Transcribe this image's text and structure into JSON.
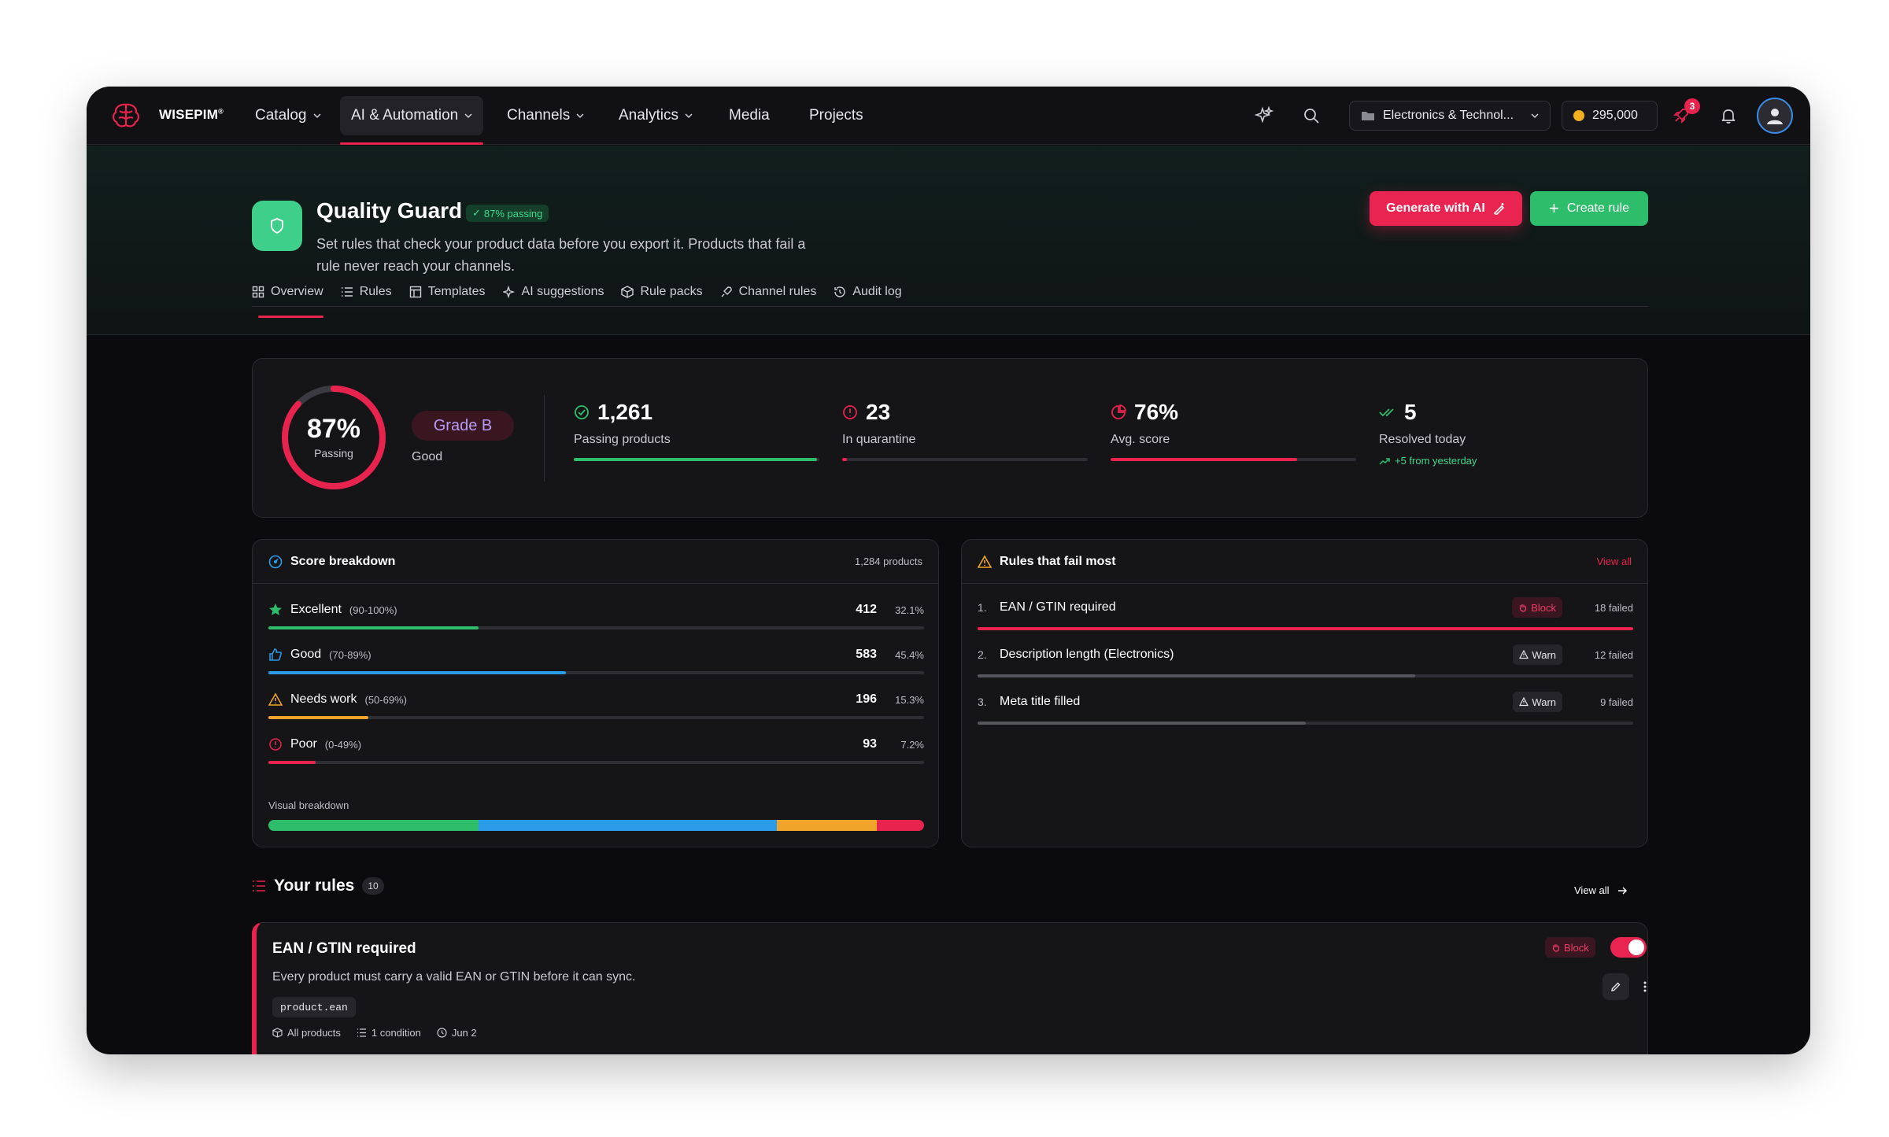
{
  "brand": {
    "name": "WISEPIM",
    "mark": "®"
  },
  "nav": {
    "items": [
      {
        "label": "Catalog",
        "dropdown": true
      },
      {
        "label": "AI & Automation",
        "dropdown": true,
        "active": true
      },
      {
        "label": "Channels",
        "dropdown": true
      },
      {
        "label": "Analytics",
        "dropdown": true
      },
      {
        "label": "Media",
        "dropdown": false
      },
      {
        "label": "Projects",
        "dropdown": false
      }
    ],
    "workspace": "Electronics & Technol...",
    "credits": "295,000",
    "notification_count": "3",
    "icons": [
      "sparkles-icon",
      "search-icon",
      "rocket-icon",
      "bell-icon",
      "user-icon"
    ]
  },
  "header": {
    "title": "Quality Guard",
    "passing_badge": "87% passing",
    "subtitle": "Set rules that check your product data before you export it. Products that fail a rule never reach your channels.",
    "generate_label": "Generate with AI",
    "create_label": "Create rule",
    "tabs": [
      {
        "label": "Overview",
        "icon": "grid-icon",
        "active": true
      },
      {
        "label": "Rules",
        "icon": "list-icon"
      },
      {
        "label": "Templates",
        "icon": "template-icon"
      },
      {
        "label": "AI suggestions",
        "icon": "sparkle-icon"
      },
      {
        "label": "Rule packs",
        "icon": "package-icon"
      },
      {
        "label": "Channel rules",
        "icon": "rocket-icon"
      },
      {
        "label": "Audit log",
        "icon": "history-icon"
      }
    ]
  },
  "overview": {
    "score": {
      "value": "87%",
      "label": "Passing",
      "fraction": 0.87
    },
    "grade": {
      "label": "Grade B",
      "sub": "Good"
    },
    "stats": [
      {
        "value": "1,261",
        "label": "Passing products",
        "fill": 0.99,
        "color": "#2dbd6b",
        "icon": "check-circle-icon"
      },
      {
        "value": "23",
        "label": "In quarantine",
        "fill": 0.02,
        "color": "#e8234d",
        "icon": "alert-circle-icon"
      },
      {
        "value": "76%",
        "label": "Avg. score",
        "fill": 0.76,
        "color": "#e8234d",
        "icon": "pie-icon"
      },
      {
        "value": "5",
        "label": "Resolved today",
        "delta": "+5 from yesterday",
        "icon": "check-double-icon"
      }
    ]
  },
  "score_breakdown": {
    "title": "Score breakdown",
    "total": "1,284 products",
    "rows": [
      {
        "name": "Excellent",
        "range": "(90-100%)",
        "count": "412",
        "pct": "32.1%",
        "fraction": 0.321,
        "color": "#2dbd6b",
        "icon": "star-icon"
      },
      {
        "name": "Good",
        "range": "(70-89%)",
        "count": "583",
        "pct": "45.4%",
        "fraction": 0.454,
        "color": "#2a9ce8",
        "icon": "thumbs-up-icon"
      },
      {
        "name": "Needs work",
        "range": "(50-69%)",
        "count": "196",
        "pct": "15.3%",
        "fraction": 0.153,
        "color": "#f0a52a",
        "icon": "warning-icon"
      },
      {
        "name": "Poor",
        "range": "(0-49%)",
        "count": "93",
        "pct": "7.2%",
        "fraction": 0.072,
        "color": "#e8234d",
        "icon": "alert-circle-icon"
      }
    ],
    "visual_label": "Visual breakdown"
  },
  "failing_rules": {
    "title": "Rules that fail most",
    "view_all": "View all",
    "rows": [
      {
        "index": "1.",
        "name": "EAN / GTIN required",
        "severity": "Block",
        "failed": "18 failed",
        "fraction": 1.0,
        "color": "#e8234d"
      },
      {
        "index": "2.",
        "name": "Description length (Electronics)",
        "severity": "Warn",
        "failed": "12 failed",
        "fraction": 0.667,
        "color": "#55555c"
      },
      {
        "index": "3.",
        "name": "Meta title filled",
        "severity": "Warn",
        "failed": "9 failed",
        "fraction": 0.5,
        "color": "#55555c"
      }
    ]
  },
  "your_rules": {
    "title": "Your rules",
    "count": "10",
    "view_all": "View all",
    "items": [
      {
        "title": "EAN / GTIN required",
        "description": "Every product must carry a valid EAN or GTIN before it can sync.",
        "field": "product.ean",
        "scope": "All products",
        "conditions": "1 condition",
        "date": "Jun 2",
        "severity": "Block",
        "enabled": true
      }
    ]
  }
}
